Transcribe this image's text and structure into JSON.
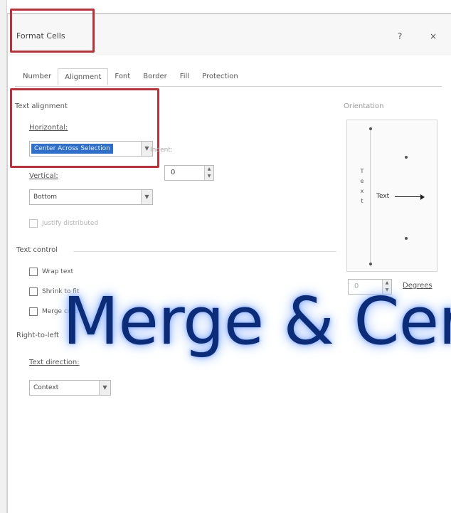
{
  "dialog": {
    "title": "Format Cells",
    "help_glyph": "?",
    "close_glyph": "×"
  },
  "tabs": [
    {
      "label": "Number"
    },
    {
      "label": "Alignment"
    },
    {
      "label": "Font"
    },
    {
      "label": "Border"
    },
    {
      "label": "Fill"
    },
    {
      "label": "Protection"
    }
  ],
  "text_alignment": {
    "section_label": "Text alignment",
    "horizontal_label": "Horizontal:",
    "horizontal_value": "Center Across Selection",
    "indent_label": "Indent:",
    "indent_value": "0",
    "vertical_label": "Vertical:",
    "vertical_value": "Bottom",
    "justify_distributed_label": "Justify distributed"
  },
  "text_control": {
    "section_label": "Text control",
    "wrap_text_label": "Wrap text",
    "shrink_to_fit_label": "Shrink to fit",
    "merge_cells_label": "Merge cells"
  },
  "right_to_left": {
    "section_label": "Right-to-left",
    "text_direction_label": "Text direction:",
    "text_direction_value": "Context"
  },
  "orientation": {
    "section_label": "Orientation",
    "vertical_text": "T e x t",
    "dial_text": "Text",
    "degrees_value": "0",
    "degrees_label": "Degrees"
  },
  "overlay": {
    "text": "Merge & Cer"
  },
  "colors": {
    "highlight_border": "#b3343d",
    "selection_fill": "#2f6fc7",
    "overlay_text": "#0d2c78",
    "overlay_glow": "#9cbcff"
  },
  "icons": {
    "dropdown": "chevron-down-icon",
    "spinner": "spinner-arrows-icon",
    "dial_arrow": "arrow-right-icon"
  }
}
